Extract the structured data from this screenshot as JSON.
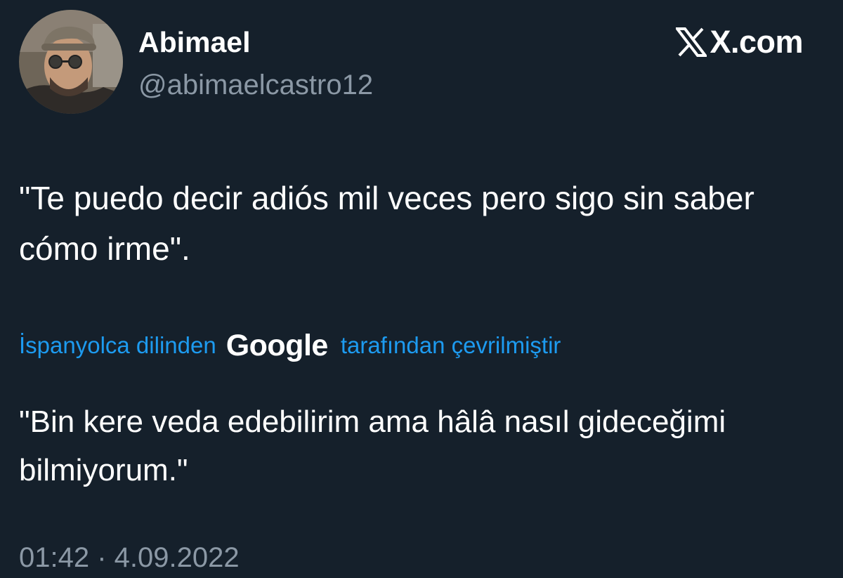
{
  "author": {
    "display_name": "Abimael",
    "handle": "@abimaelcastro12"
  },
  "brand": {
    "icon": "x-logo-icon",
    "text": "X.com"
  },
  "tweet": {
    "text": "\"Te puedo decir adiós mil veces pero sigo sin saber cómo irme\"."
  },
  "translation": {
    "prefix": "İspanyolca dilinden",
    "provider": "Google",
    "suffix": "tarafından çevrilmiştir",
    "text": "\"Bin kere veda edebilirim ama hâlâ nasıl gideceğimi bilmiyorum.\""
  },
  "meta": {
    "timestamp": "01:42 · 4.09.2022"
  },
  "colors": {
    "background": "#15202b",
    "primary_text": "#ffffff",
    "secondary_text": "#8b98a5",
    "link": "#1d9bf0"
  }
}
